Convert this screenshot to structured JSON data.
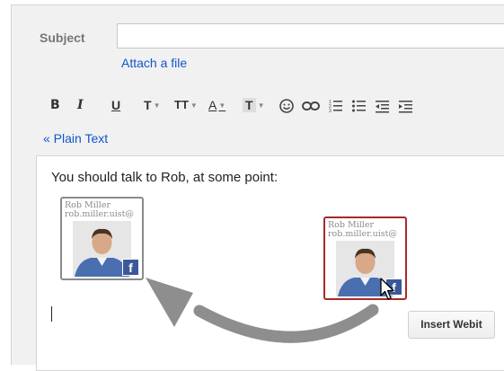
{
  "compose": {
    "subject_label": "Subject",
    "subject_value": "",
    "attach_link": "Attach a file",
    "plain_text_link": "« Plain Text"
  },
  "toolbar": {
    "bold": "B",
    "italic": "I",
    "underline": "U",
    "font": "T",
    "size": "TT",
    "text_color": "A",
    "highlight": "T"
  },
  "editor": {
    "body_text": "You should talk to Rob, at some point:"
  },
  "webits": [
    {
      "name": "Rob Miller",
      "email": "rob.miller.uist@",
      "badge": "f"
    },
    {
      "name": "Rob Miller",
      "email": "rob.miller.uist@",
      "badge": "f"
    }
  ],
  "insert_button": "Insert Webit",
  "colors": {
    "link": "#1155cc",
    "selected_border": "#a72a2a",
    "facebook": "#3b5998",
    "arrow": "#8e8e8e"
  }
}
